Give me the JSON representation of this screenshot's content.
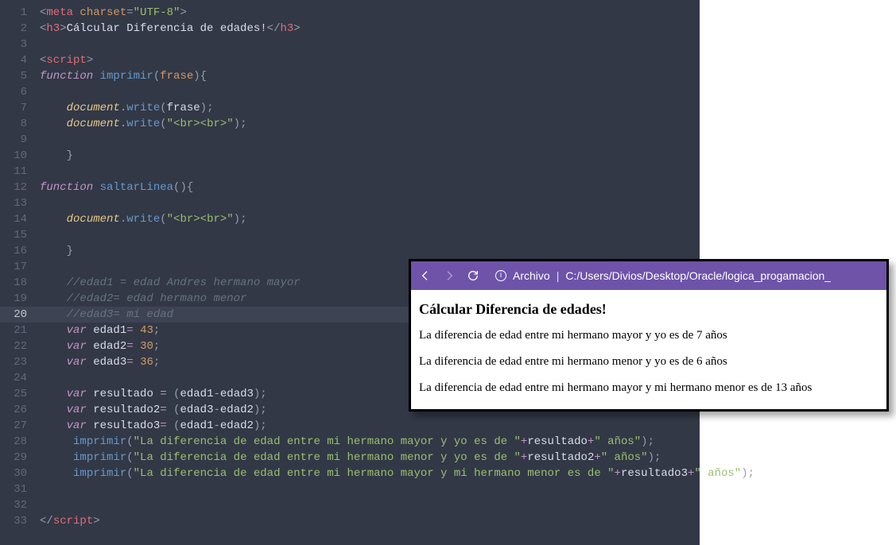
{
  "editor": {
    "lines": [
      [
        {
          "c": "pun",
          "t": "<"
        },
        {
          "c": "tag",
          "t": "meta"
        },
        {
          "c": "txt",
          "t": " "
        },
        {
          "c": "attr",
          "t": "charset"
        },
        {
          "c": "pun",
          "t": "="
        },
        {
          "c": "str",
          "t": "\"UTF-8\""
        },
        {
          "c": "pun",
          "t": ">"
        }
      ],
      [
        {
          "c": "pun",
          "t": "<"
        },
        {
          "c": "tag",
          "t": "h3"
        },
        {
          "c": "pun",
          "t": ">"
        },
        {
          "c": "txt",
          "t": "Cálcular Diferencia de edades!"
        },
        {
          "c": "pun",
          "t": "</"
        },
        {
          "c": "tag",
          "t": "h3"
        },
        {
          "c": "pun",
          "t": ">"
        }
      ],
      [],
      [
        {
          "c": "pun",
          "t": "<"
        },
        {
          "c": "tag",
          "t": "script"
        },
        {
          "c": "pun",
          "t": ">"
        }
      ],
      [
        {
          "c": "kw",
          "t": "function"
        },
        {
          "c": "txt",
          "t": " "
        },
        {
          "c": "fn",
          "t": "imprimir"
        },
        {
          "c": "pun",
          "t": "("
        },
        {
          "c": "id",
          "t": "frase"
        },
        {
          "c": "pun",
          "t": "){"
        }
      ],
      [],
      [
        {
          "c": "txt",
          "t": "    "
        },
        {
          "c": "obj",
          "t": "document"
        },
        {
          "c": "pun",
          "t": "."
        },
        {
          "c": "fn",
          "t": "write"
        },
        {
          "c": "pun",
          "t": "("
        },
        {
          "c": "txt",
          "t": "frase"
        },
        {
          "c": "pun",
          "t": ");"
        }
      ],
      [
        {
          "c": "txt",
          "t": "    "
        },
        {
          "c": "obj",
          "t": "document"
        },
        {
          "c": "pun",
          "t": "."
        },
        {
          "c": "fn",
          "t": "write"
        },
        {
          "c": "pun",
          "t": "("
        },
        {
          "c": "str",
          "t": "\"<br><br>\""
        },
        {
          "c": "pun",
          "t": ");"
        }
      ],
      [],
      [
        {
          "c": "txt",
          "t": "    "
        },
        {
          "c": "pun",
          "t": "}"
        }
      ],
      [],
      [
        {
          "c": "kw",
          "t": "function"
        },
        {
          "c": "txt",
          "t": " "
        },
        {
          "c": "fn",
          "t": "saltarLinea"
        },
        {
          "c": "pun",
          "t": "(){"
        }
      ],
      [],
      [
        {
          "c": "txt",
          "t": "    "
        },
        {
          "c": "obj",
          "t": "document"
        },
        {
          "c": "pun",
          "t": "."
        },
        {
          "c": "fn",
          "t": "write"
        },
        {
          "c": "pun",
          "t": "("
        },
        {
          "c": "str",
          "t": "\"<br><br>\""
        },
        {
          "c": "pun",
          "t": ");"
        }
      ],
      [],
      [
        {
          "c": "txt",
          "t": "    "
        },
        {
          "c": "pun",
          "t": "}"
        }
      ],
      [],
      [
        {
          "c": "txt",
          "t": "    "
        },
        {
          "c": "cm",
          "t": "//edad1 = edad Andres hermano mayor"
        }
      ],
      [
        {
          "c": "txt",
          "t": "    "
        },
        {
          "c": "cm",
          "t": "//edad2= edad hermano menor"
        }
      ],
      [
        {
          "c": "txt",
          "t": "    "
        },
        {
          "c": "cm",
          "t": "//edad3= mi edad"
        }
      ],
      [
        {
          "c": "txt",
          "t": "    "
        },
        {
          "c": "kw",
          "t": "var"
        },
        {
          "c": "txt",
          "t": " edad1"
        },
        {
          "c": "op",
          "t": "="
        },
        {
          "c": "txt",
          "t": " "
        },
        {
          "c": "num",
          "t": "43"
        },
        {
          "c": "pun",
          "t": ";"
        }
      ],
      [
        {
          "c": "txt",
          "t": "    "
        },
        {
          "c": "kw",
          "t": "var"
        },
        {
          "c": "txt",
          "t": " edad2"
        },
        {
          "c": "op",
          "t": "="
        },
        {
          "c": "txt",
          "t": " "
        },
        {
          "c": "num",
          "t": "30"
        },
        {
          "c": "pun",
          "t": ";"
        }
      ],
      [
        {
          "c": "txt",
          "t": "    "
        },
        {
          "c": "kw",
          "t": "var"
        },
        {
          "c": "txt",
          "t": " edad3"
        },
        {
          "c": "op",
          "t": "="
        },
        {
          "c": "txt",
          "t": " "
        },
        {
          "c": "num",
          "t": "36"
        },
        {
          "c": "pun",
          "t": ";"
        }
      ],
      [],
      [
        {
          "c": "txt",
          "t": "    "
        },
        {
          "c": "kw",
          "t": "var"
        },
        {
          "c": "txt",
          "t": " resultado "
        },
        {
          "c": "op",
          "t": "="
        },
        {
          "c": "txt",
          "t": " "
        },
        {
          "c": "pun",
          "t": "("
        },
        {
          "c": "txt",
          "t": "edad1"
        },
        {
          "c": "op",
          "t": "-"
        },
        {
          "c": "txt",
          "t": "edad3"
        },
        {
          "c": "pun",
          "t": ");"
        }
      ],
      [
        {
          "c": "txt",
          "t": "    "
        },
        {
          "c": "kw",
          "t": "var"
        },
        {
          "c": "txt",
          "t": " resultado2"
        },
        {
          "c": "op",
          "t": "="
        },
        {
          "c": "txt",
          "t": " "
        },
        {
          "c": "pun",
          "t": "("
        },
        {
          "c": "txt",
          "t": "edad3"
        },
        {
          "c": "op",
          "t": "-"
        },
        {
          "c": "txt",
          "t": "edad2"
        },
        {
          "c": "pun",
          "t": ");"
        }
      ],
      [
        {
          "c": "txt",
          "t": "    "
        },
        {
          "c": "kw",
          "t": "var"
        },
        {
          "c": "txt",
          "t": " resultado3"
        },
        {
          "c": "op",
          "t": "="
        },
        {
          "c": "txt",
          "t": " "
        },
        {
          "c": "pun",
          "t": "("
        },
        {
          "c": "txt",
          "t": "edad1"
        },
        {
          "c": "op",
          "t": "-"
        },
        {
          "c": "txt",
          "t": "edad2"
        },
        {
          "c": "pun",
          "t": ");"
        }
      ],
      [
        {
          "c": "txt",
          "t": "     "
        },
        {
          "c": "fn",
          "t": "imprimir"
        },
        {
          "c": "pun",
          "t": "("
        },
        {
          "c": "str",
          "t": "\"La diferencia de edad entre mi hermano mayor y yo es de \""
        },
        {
          "c": "op",
          "t": "+"
        },
        {
          "c": "txt",
          "t": "resultado"
        },
        {
          "c": "op",
          "t": "+"
        },
        {
          "c": "str",
          "t": "\" años\""
        },
        {
          "c": "pun",
          "t": ");"
        }
      ],
      [
        {
          "c": "txt",
          "t": "     "
        },
        {
          "c": "fn",
          "t": "imprimir"
        },
        {
          "c": "pun",
          "t": "("
        },
        {
          "c": "str",
          "t": "\"La diferencia de edad entre mi hermano menor y yo es de \""
        },
        {
          "c": "op",
          "t": "+"
        },
        {
          "c": "txt",
          "t": "resultado2"
        },
        {
          "c": "op",
          "t": "+"
        },
        {
          "c": "str",
          "t": "\" años\""
        },
        {
          "c": "pun",
          "t": ");"
        }
      ],
      [
        {
          "c": "txt",
          "t": "     "
        },
        {
          "c": "fn",
          "t": "imprimir"
        },
        {
          "c": "pun",
          "t": "("
        },
        {
          "c": "str",
          "t": "\"La diferencia de edad entre mi hermano mayor y mi hermano menor es de \""
        },
        {
          "c": "op",
          "t": "+"
        },
        {
          "c": "txt",
          "t": "resultado3"
        },
        {
          "c": "op",
          "t": "+"
        },
        {
          "c": "str",
          "t": "\" años\""
        },
        {
          "c": "pun",
          "t": ");"
        }
      ],
      [],
      [],
      [
        {
          "c": "pun",
          "t": "</"
        },
        {
          "c": "tag",
          "t": "script"
        },
        {
          "c": "pun",
          "t": ">"
        }
      ]
    ],
    "current_line": 20
  },
  "browser": {
    "address_label": "Archivo",
    "address_path": "C:/Users/Divios/Desktop/Oracle/logica_progamacion_",
    "heading": "Cálcular Diferencia de edades!",
    "paragraphs": [
      "La diferencia de edad entre mi hermano mayor y yo es de 7 años",
      "La diferencia de edad entre mi hermano menor y yo es de 6 años",
      "La diferencia de edad entre mi hermano mayor y mi hermano menor es de 13 años"
    ]
  }
}
